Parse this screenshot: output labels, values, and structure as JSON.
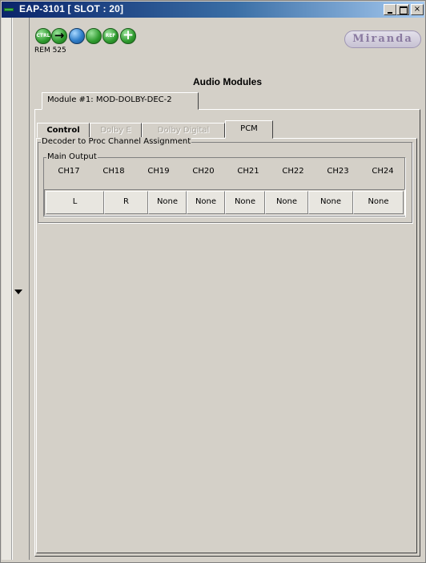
{
  "window": {
    "title": "EAP-3101 [ SLOT : 20]",
    "minimize_label": "_",
    "maximize_label": "",
    "close_label": "×"
  },
  "toolbar": {
    "icons": [
      {
        "name": "ctrl-status-icon",
        "label": "CTRL"
      },
      {
        "name": "input-arrow-icon",
        "label": ""
      },
      {
        "name": "loop-arrow-icon",
        "label": ""
      },
      {
        "name": "audio-status-icon",
        "label": ""
      },
      {
        "name": "ref-status-icon",
        "label": "REF"
      },
      {
        "name": "add-icon",
        "label": ""
      }
    ],
    "rem_label": "REM 525",
    "logo": "Miranda"
  },
  "page": {
    "heading": "Audio Modules",
    "module_tab": "Module #1: MOD-DOLBY-DEC-2"
  },
  "tabs": [
    {
      "label": "Control",
      "state": "normal"
    },
    {
      "label": "Dolby E",
      "state": "disabled"
    },
    {
      "label": "Dolby Digital",
      "state": "disabled"
    },
    {
      "label": "PCM",
      "state": "active"
    }
  ],
  "assignment": {
    "group_title": "Decoder to Proc Channel Assignment",
    "sub_group_title": "Main Output",
    "channels": [
      {
        "name": "CH17",
        "value": "L"
      },
      {
        "name": "CH18",
        "value": "R"
      },
      {
        "name": "CH19",
        "value": "None"
      },
      {
        "name": "CH20",
        "value": "None"
      },
      {
        "name": "CH21",
        "value": "None"
      },
      {
        "name": "CH22",
        "value": "None"
      },
      {
        "name": "CH23",
        "value": "None"
      },
      {
        "name": "CH24",
        "value": "None"
      }
    ]
  },
  "colors": {
    "title_bar": "#0a246a",
    "panel_bg": "#d4d0c8",
    "status_icon": "#2e9a2e",
    "logo": "#8a7aa0"
  }
}
